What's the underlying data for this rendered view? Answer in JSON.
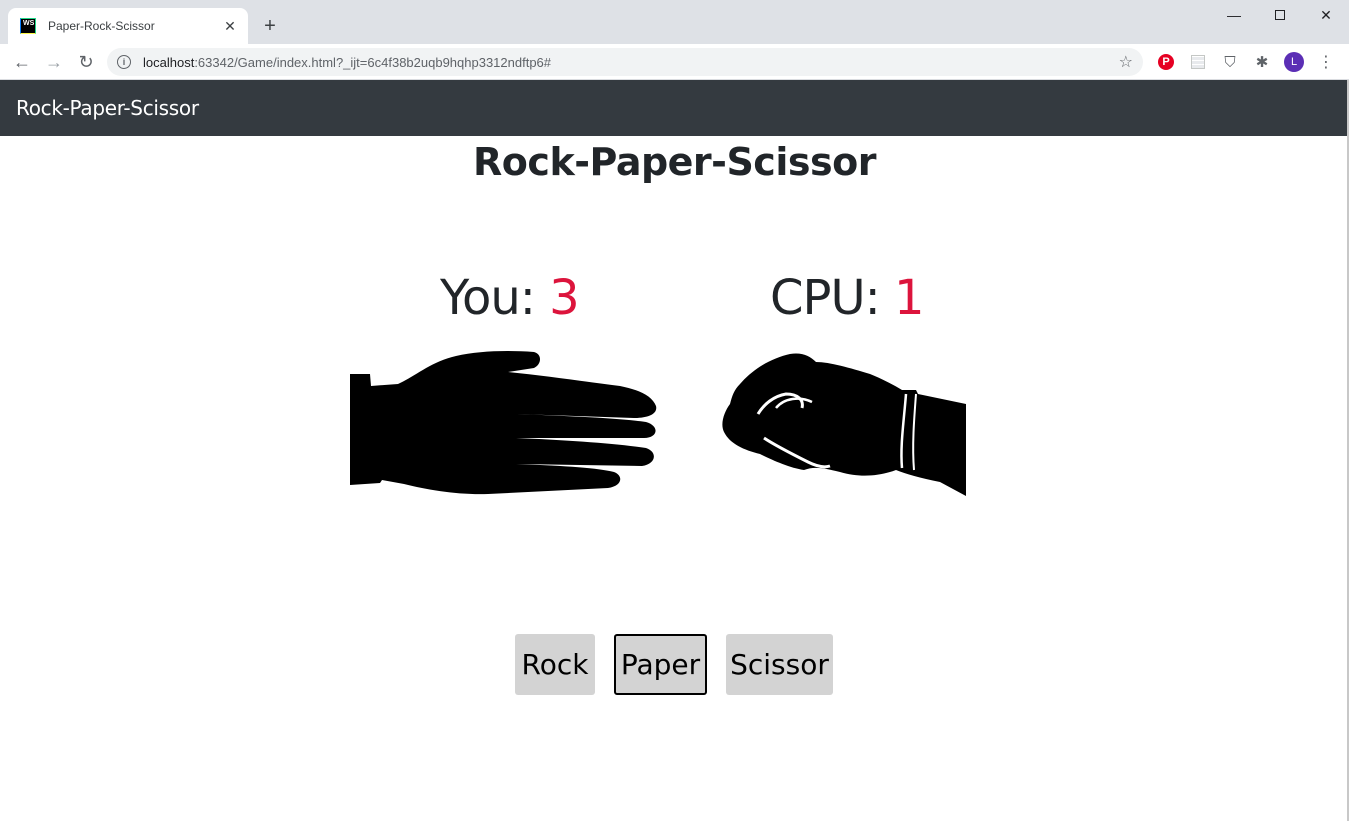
{
  "browser": {
    "tab_title": "Paper-Rock-Scissor",
    "favicon_text": "WS",
    "url_host": "localhost",
    "url_rest": ":63342/Game/index.html?_ijt=6c4f38b2uqb9hqhp3312ndftp6#",
    "avatar_letter": "L"
  },
  "navbar": {
    "brand": "Rock-Paper-Scissor"
  },
  "game": {
    "title": "Rock-Paper-Scissor",
    "you_label": "You: ",
    "you_score": "3",
    "cpu_label": "CPU: ",
    "cpu_score": "1",
    "you_hand": "paper-hand-icon",
    "cpu_hand": "rock-fist-icon",
    "score_color": "#dc143c"
  },
  "choices": {
    "rock": "Rock",
    "paper": "Paper",
    "scissor": "Scissor",
    "focused": "Paper"
  }
}
